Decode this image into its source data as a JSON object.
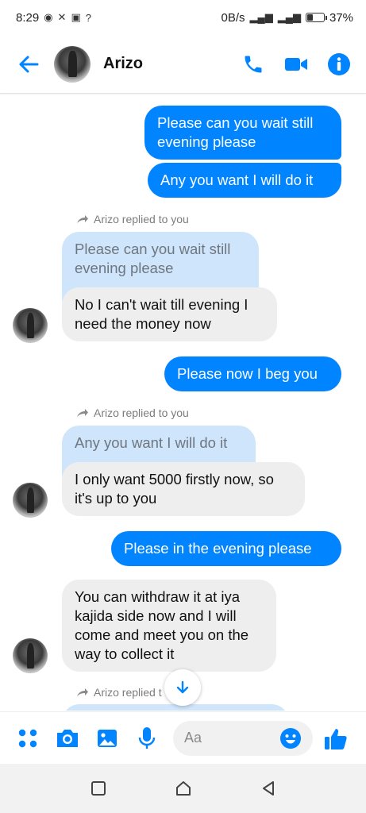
{
  "status_bar": {
    "time": "8:29",
    "network_speed": "0B/s",
    "battery": "37%",
    "battery_level": 0.37
  },
  "header": {
    "contact_name": "Arizo"
  },
  "messages": [
    {
      "type": "out",
      "text": "Please can you wait still evening please"
    },
    {
      "type": "out",
      "text": "Any you want I will do it"
    },
    {
      "type": "reply_note",
      "text": "Arizo replied to you"
    },
    {
      "type": "quoted",
      "text": "Please can you wait still evening please"
    },
    {
      "type": "in",
      "text": "No I can't wait till evening I need the money now"
    },
    {
      "type": "out",
      "text": "Please now I beg you"
    },
    {
      "type": "reply_note",
      "text": "Arizo replied to you"
    },
    {
      "type": "quoted",
      "text": "Any you want I will do it"
    },
    {
      "type": "in",
      "text": "I only want 5000 firstly now, so it's up to you"
    },
    {
      "type": "out",
      "text": "Please in the evening please"
    },
    {
      "type": "in",
      "text": "You can withdraw it at iya kajida side now and I will come and meet you on the way to collect it"
    },
    {
      "type": "reply_note",
      "text": "Arizo replied t"
    }
  ],
  "composer": {
    "placeholder": "Aa"
  },
  "colors": {
    "accent": "#0084ff",
    "incoming_bubble": "#eeeeee",
    "quoted_bubble": "#cfe5fb"
  },
  "icons": [
    "back-arrow-icon",
    "phone-icon",
    "video-camera-icon",
    "info-icon",
    "apps-icon",
    "camera-icon",
    "gallery-icon",
    "microphone-icon",
    "emoji-icon",
    "thumbs-up-icon",
    "scroll-down-icon",
    "square-icon",
    "home-icon",
    "back-triangle-icon"
  ]
}
